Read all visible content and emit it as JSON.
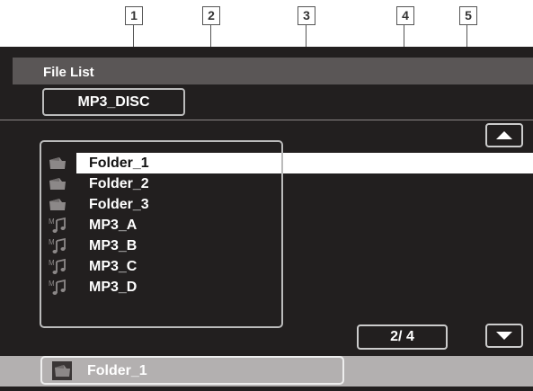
{
  "callouts": [
    "1",
    "2",
    "3",
    "4",
    "5"
  ],
  "header": {
    "title": "File List",
    "disc_name": "MP3_DISC"
  },
  "list": {
    "items": [
      {
        "label": "Folder_1",
        "icon": "folder-icon",
        "selected": true
      },
      {
        "label": "Folder_2",
        "icon": "folder-icon",
        "selected": false
      },
      {
        "label": "Folder_3",
        "icon": "folder-icon",
        "selected": false
      },
      {
        "label": "MP3_A",
        "icon": "mp3-file-icon",
        "selected": false
      },
      {
        "label": "MP3_B",
        "icon": "mp3-file-icon",
        "selected": false
      },
      {
        "label": "MP3_C",
        "icon": "mp3-file-icon",
        "selected": false
      },
      {
        "label": "MP3_D",
        "icon": "mp3-file-icon",
        "selected": false
      }
    ]
  },
  "page_indicator": "2/ 4",
  "page": {
    "current": 2,
    "total": 4
  },
  "status": {
    "current_label": "Folder_1",
    "icon": "folder-icon"
  },
  "colors": {
    "screen_bg": "#221f1f",
    "title_bar": "#5a5656",
    "status_bar": "#b3b0b0",
    "selection": "#ffffff",
    "text": "#ffffff"
  }
}
